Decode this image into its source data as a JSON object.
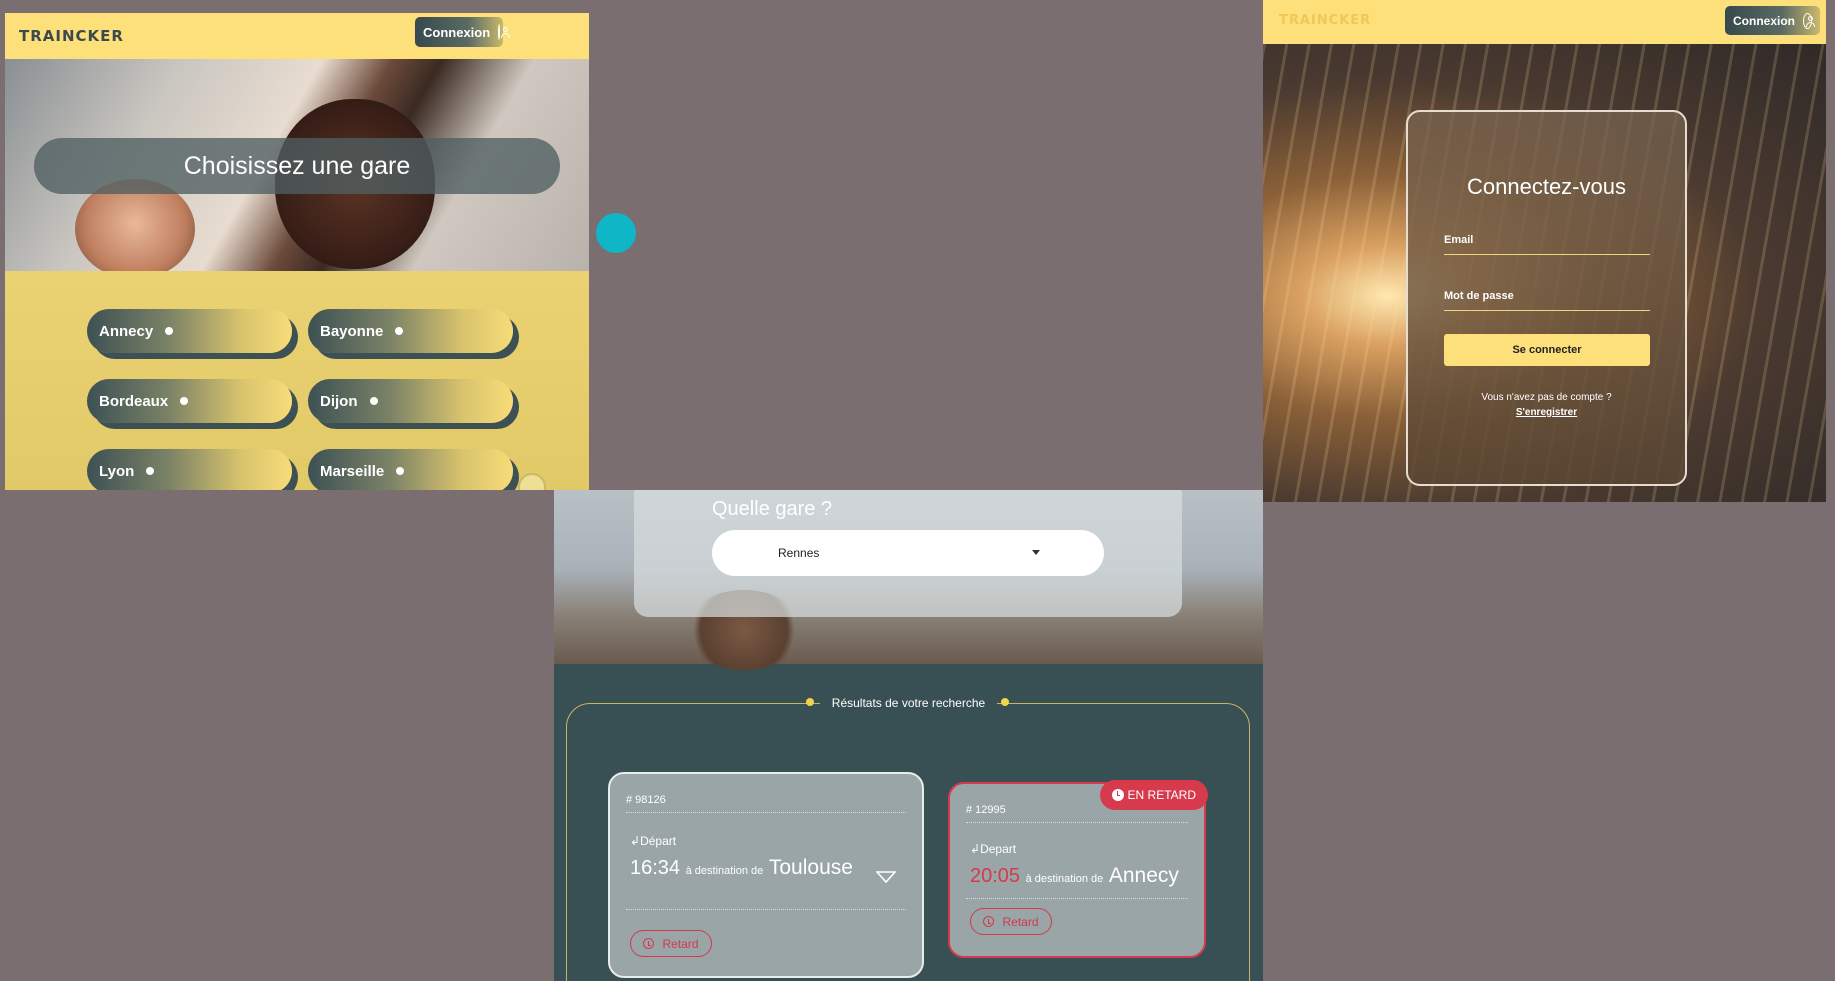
{
  "brand": {
    "logo": "TRAINCKER",
    "login_label": "Connexion"
  },
  "station_select": {
    "title": "Choisissez une gare",
    "cities": [
      "Annecy",
      "Bayonne",
      "Bordeaux",
      "Dijon",
      "Lyon",
      "Marseille"
    ]
  },
  "login": {
    "title": "Connectez-vous",
    "email_label": "Email",
    "password_label": "Mot de passe",
    "submit_label": "Se connecter",
    "no_account": "Vous n'avez pas de compte ?",
    "register_link": "S'enregistrer"
  },
  "search": {
    "question": "Quelle gare ?",
    "selected_station": "Rennes",
    "results_title": "Résultats de votre recherche"
  },
  "trains": [
    {
      "number": "# 98126",
      "direction": "Départ",
      "time": "16:34",
      "dest_prefix": "à destination de",
      "destination": "Toulouse",
      "action": "Retard",
      "late": false
    },
    {
      "number": "# 12995",
      "direction": "Depart",
      "time": "20:05",
      "dest_prefix": "à destination de",
      "destination": "Annecy",
      "action": "Retard",
      "late": true,
      "badge": "EN RETARD"
    }
  ],
  "colors": {
    "brand_yellow": "#fde07a",
    "dark_teal": "#384f53",
    "late_red": "#d63a4c",
    "accent_teal": "#0fb7c6",
    "background": "#7a6e70"
  }
}
